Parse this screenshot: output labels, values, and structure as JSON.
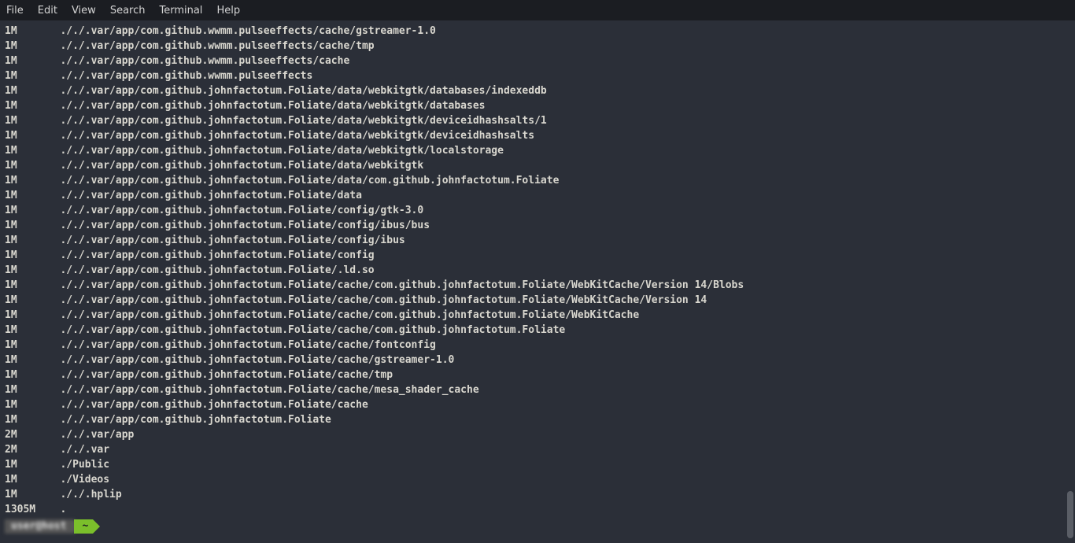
{
  "menubar": {
    "items": [
      "File",
      "Edit",
      "View",
      "Search",
      "Terminal",
      "Help"
    ]
  },
  "prompt": {
    "host_segment": "user@host",
    "dir_segment": "~"
  },
  "output_rows": [
    {
      "size": "1M",
      "path": "././.var/app/com.github.wwmm.pulseeffects/cache/gstreamer-1.0"
    },
    {
      "size": "1M",
      "path": "././.var/app/com.github.wwmm.pulseeffects/cache/tmp"
    },
    {
      "size": "1M",
      "path": "././.var/app/com.github.wwmm.pulseeffects/cache"
    },
    {
      "size": "1M",
      "path": "././.var/app/com.github.wwmm.pulseeffects"
    },
    {
      "size": "1M",
      "path": "././.var/app/com.github.johnfactotum.Foliate/data/webkitgtk/databases/indexeddb"
    },
    {
      "size": "1M",
      "path": "././.var/app/com.github.johnfactotum.Foliate/data/webkitgtk/databases"
    },
    {
      "size": "1M",
      "path": "././.var/app/com.github.johnfactotum.Foliate/data/webkitgtk/deviceidhashsalts/1"
    },
    {
      "size": "1M",
      "path": "././.var/app/com.github.johnfactotum.Foliate/data/webkitgtk/deviceidhashsalts"
    },
    {
      "size": "1M",
      "path": "././.var/app/com.github.johnfactotum.Foliate/data/webkitgtk/localstorage"
    },
    {
      "size": "1M",
      "path": "././.var/app/com.github.johnfactotum.Foliate/data/webkitgtk"
    },
    {
      "size": "1M",
      "path": "././.var/app/com.github.johnfactotum.Foliate/data/com.github.johnfactotum.Foliate"
    },
    {
      "size": "1M",
      "path": "././.var/app/com.github.johnfactotum.Foliate/data"
    },
    {
      "size": "1M",
      "path": "././.var/app/com.github.johnfactotum.Foliate/config/gtk-3.0"
    },
    {
      "size": "1M",
      "path": "././.var/app/com.github.johnfactotum.Foliate/config/ibus/bus"
    },
    {
      "size": "1M",
      "path": "././.var/app/com.github.johnfactotum.Foliate/config/ibus"
    },
    {
      "size": "1M",
      "path": "././.var/app/com.github.johnfactotum.Foliate/config"
    },
    {
      "size": "1M",
      "path": "././.var/app/com.github.johnfactotum.Foliate/.ld.so"
    },
    {
      "size": "1M",
      "path": "././.var/app/com.github.johnfactotum.Foliate/cache/com.github.johnfactotum.Foliate/WebKitCache/Version 14/Blobs"
    },
    {
      "size": "1M",
      "path": "././.var/app/com.github.johnfactotum.Foliate/cache/com.github.johnfactotum.Foliate/WebKitCache/Version 14"
    },
    {
      "size": "1M",
      "path": "././.var/app/com.github.johnfactotum.Foliate/cache/com.github.johnfactotum.Foliate/WebKitCache"
    },
    {
      "size": "1M",
      "path": "././.var/app/com.github.johnfactotum.Foliate/cache/com.github.johnfactotum.Foliate"
    },
    {
      "size": "1M",
      "path": "././.var/app/com.github.johnfactotum.Foliate/cache/fontconfig"
    },
    {
      "size": "1M",
      "path": "././.var/app/com.github.johnfactotum.Foliate/cache/gstreamer-1.0"
    },
    {
      "size": "1M",
      "path": "././.var/app/com.github.johnfactotum.Foliate/cache/tmp"
    },
    {
      "size": "1M",
      "path": "././.var/app/com.github.johnfactotum.Foliate/cache/mesa_shader_cache"
    },
    {
      "size": "1M",
      "path": "././.var/app/com.github.johnfactotum.Foliate/cache"
    },
    {
      "size": "1M",
      "path": "././.var/app/com.github.johnfactotum.Foliate"
    },
    {
      "size": "2M",
      "path": "././.var/app"
    },
    {
      "size": "2M",
      "path": "././.var"
    },
    {
      "size": "1M",
      "path": "./Public"
    },
    {
      "size": "1M",
      "path": "./Videos"
    },
    {
      "size": "1M",
      "path": "././.hplip"
    },
    {
      "size": "1305M",
      "path": "."
    }
  ]
}
